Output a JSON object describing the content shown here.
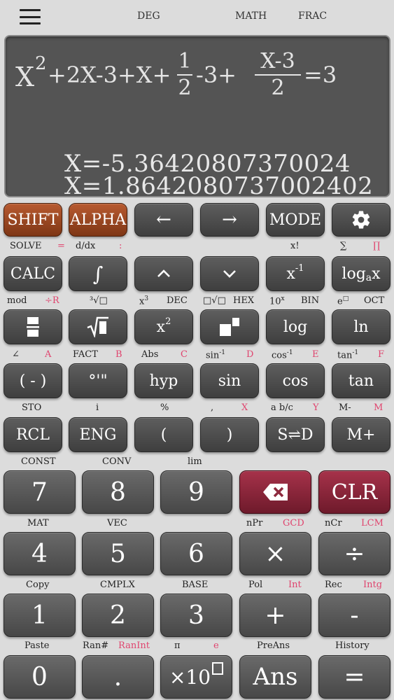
{
  "status": {
    "angle": "DEG",
    "input_mode": "MATH",
    "output_mode": "FRAC"
  },
  "display": {
    "expression": {
      "x2_base": "X",
      "x2_exp": "2",
      "part1": "+2X-3+X+",
      "frac1_num": "1",
      "frac1_den": "2",
      "part2": "-3+",
      "frac2_num": "X-3",
      "frac2_den": "2",
      "part3": "=3"
    },
    "results": [
      "X=-5.36420807370024",
      "X=1.8642080737002402"
    ]
  },
  "rows": {
    "r1": {
      "shift": "SHIFT",
      "alpha": "ALPHA",
      "left": "←",
      "right": "→",
      "mode": "MODE"
    },
    "r1_labels": {
      "solve": "SOLVE",
      "eq": "=",
      "ddx": "d/dx",
      "colon": ":",
      "fact_x": "x!",
      "sum": "∑",
      "prod": "∏"
    },
    "r2": {
      "calc": "CALC",
      "integral": "∫",
      "up": "⌃",
      "down": "⌄",
      "x_inv_base": "x",
      "x_inv_exp": "-1",
      "log_a_pre": "log",
      "log_a_sub": "a",
      "log_a_post": "x"
    },
    "r2_labels": {
      "mod": "mod",
      "div_r": "÷R",
      "cube_root": "³√□",
      "x3_base": "x",
      "x3_exp": "3",
      "dec": "DEC",
      "nroot": "□√□",
      "hex": "HEX",
      "ten_base": "10",
      "ten_exp": "x",
      "bin": "BIN",
      "e_base": "e",
      "e_exp": "□",
      "oct": "OCT"
    },
    "r3": {
      "frac": "",
      "sqrt": "√",
      "x2_base": "x",
      "x2_exp": "2",
      "pow": "",
      "log": "log",
      "ln": "ln"
    },
    "r3_labels": {
      "angle": "∠",
      "a": "A",
      "fact": "FACT",
      "b": "B",
      "abs": "Abs",
      "c": "C",
      "sin_base": "sin",
      "sin_exp": "-1",
      "d": "D",
      "cos_base": "cos",
      "cos_exp": "-1",
      "e": "E",
      "tan_base": "tan",
      "tan_exp": "-1",
      "f": "F"
    },
    "r4": {
      "neg": "( - )",
      "dms": "°'\"",
      "hyp": "hyp",
      "sin": "sin",
      "cos": "cos",
      "tan": "tan"
    },
    "r4_labels": {
      "sto": "STO",
      "i": "i",
      "pct": "%",
      "comma": ",",
      "x": "X",
      "abc": "a b/c",
      "y": "Y",
      "mminus": "M-",
      "m": "M"
    },
    "r5": {
      "rcl": "RCL",
      "eng": "ENG",
      "lparen": "(",
      "rparen": ")",
      "sd": "S⇌D",
      "mplus": "M+"
    },
    "r5_labels": {
      "const": "CONST",
      "conv": "CONV",
      "lim": "lim"
    },
    "r6": {
      "k7": "7",
      "k8": "8",
      "k9": "9",
      "clr": "CLR"
    },
    "r6_labels": {
      "mat": "MAT",
      "vec": "VEC",
      "npr": "nPr",
      "gcd": "GCD",
      "ncr": "nCr",
      "lcm": "LCM"
    },
    "r7": {
      "k4": "4",
      "k5": "5",
      "k6": "6",
      "mul": "×",
      "div": "÷"
    },
    "r7_labels": {
      "copy": "Copy",
      "cmplx": "CMPLX",
      "base": "BASE",
      "pol": "Pol",
      "int": "Int",
      "rec": "Rec",
      "intg": "Intg"
    },
    "r8": {
      "k1": "1",
      "k2": "2",
      "k3": "3",
      "plus": "+",
      "minus": "-"
    },
    "r8_labels": {
      "paste": "Paste",
      "ran": "Ran#",
      "ranint": "RanInt",
      "pi": "π",
      "e": "e",
      "preans": "PreAns",
      "history": "History"
    },
    "r9": {
      "k0": "0",
      "dot": ".",
      "exp_base": "×10",
      "exp_box": "□",
      "ans": "Ans",
      "eq": "="
    }
  },
  "colors": {
    "shift": "#9c4a22",
    "alpha": "#9c4a22",
    "del": "#8e2a3e",
    "clr": "#8e2a3e",
    "alpha_label": "#e0446e",
    "screen": "#545454"
  }
}
